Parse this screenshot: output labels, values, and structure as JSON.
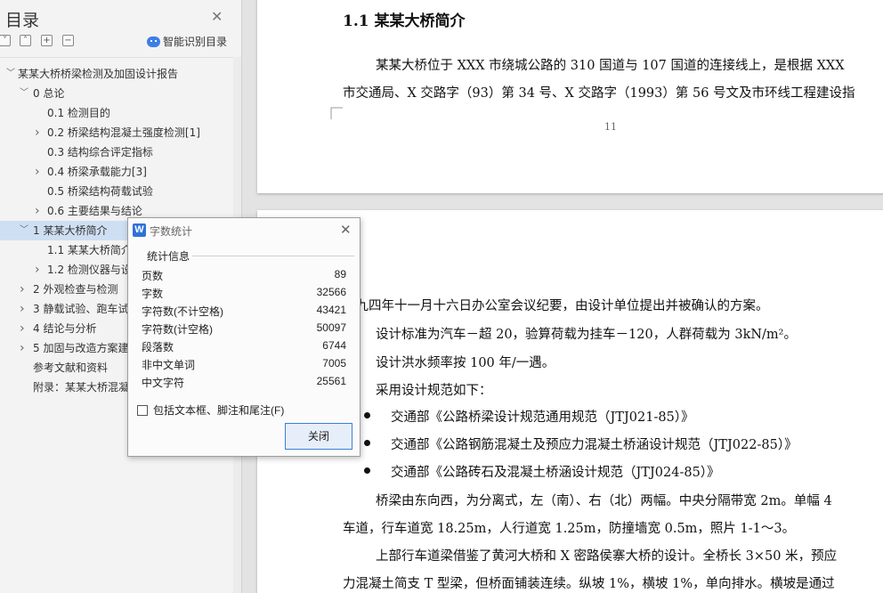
{
  "nav": {
    "title": "目录",
    "smart_label": "智能识别目录",
    "items": [
      {
        "label": "某某大桥桥梁检测及加固设计报告",
        "caret": "﹀"
      },
      {
        "label": "0  总论",
        "caret": "﹀"
      },
      {
        "label": "0.1  检测目的",
        "caret": ""
      },
      {
        "label": "0.2  桥梁结构混凝土强度检测[1]",
        "caret": "›"
      },
      {
        "label": "0.3  结构综合评定指标",
        "caret": ""
      },
      {
        "label": "0.4 桥梁承载能力[3]",
        "caret": "›"
      },
      {
        "label": "0.5  桥梁结构荷载试验",
        "caret": ""
      },
      {
        "label": "0.6  主要结果与结论",
        "caret": "›"
      },
      {
        "label": "1 某某大桥简介",
        "caret": "﹀"
      },
      {
        "label": "1.1 某某大桥简介",
        "caret": ""
      },
      {
        "label": "1.2  检测仪器与设备",
        "caret": "›"
      },
      {
        "label": "2  外观检查与检测",
        "caret": "›"
      },
      {
        "label": "3  静载试验、跑车试验",
        "caret": "›"
      },
      {
        "label": "4  结论与分析",
        "caret": "›"
      },
      {
        "label": "5  加固与改造方案建议",
        "caret": "›"
      },
      {
        "label": "参考文献和资料",
        "caret": ""
      },
      {
        "label": "附录：某某大桥混凝土",
        "caret": ""
      }
    ]
  },
  "document": {
    "heading": "1.1 某某大桥简介",
    "p1_line1": "某某大桥位于 XXX 市绕城公路的 310 国道与 107 国道的连接线上，是根据 XXX",
    "p1_line2": "市交通局、X 交路字（93）第 34 号、X 交路字（1993）第 56 号文及市环线工程建设指",
    "page_number": "11",
    "lines": [
      "部九四年十一月十六日办公室会议纪要，由设计单位提出并被确认的方案。",
      "设计标准为汽车－超 20，验算荷载为挂车－120，人群荷载为 3kN/m²。",
      "设计洪水频率按 100 年/一遇。",
      "采用设计规范如下："
    ],
    "bullets": [
      "交通部《公路桥梁设计规范通用规范（JTJ021-85）》",
      "交通部《公路钢筋混凝土及预应力混凝土桥涵设计规范（JTJ022-85）》",
      "交通部《公路砖石及混凝土桥涵设计规范（JTJ024-85）》"
    ],
    "tail": [
      "桥梁由东向西，为分离式，左（南）、右（北）两幅。中央分隔带宽 2m。单幅 4",
      "车道，行车道宽 18.25m，人行道宽 1.25m，防撞墙宽 0.5m，照片 1-1～3。",
      "上部行车道梁借鉴了黄河大桥和 X 密路侯寨大桥的设计。全桥长 3×50 米，预应",
      "力混凝土简支 T 型梁，但桥面铺装连续。纵坡 1%，横坡 1%，单向排水。横坡是通过"
    ]
  },
  "dialog": {
    "title": "字数统计",
    "group_label": "统计信息",
    "rows": [
      {
        "key": "页数",
        "value": "89"
      },
      {
        "key": "字数",
        "value": "32566"
      },
      {
        "key": "字符数(不计空格)",
        "value": "43421"
      },
      {
        "key": "字符数(计空格)",
        "value": "50097"
      },
      {
        "key": "段落数",
        "value": "6744"
      },
      {
        "key": "非中文单词",
        "value": "7005"
      },
      {
        "key": "中文字符",
        "value": "25561"
      }
    ],
    "checkbox_label": "包括文本框、脚注和尾注(F)",
    "close_label": "关闭"
  }
}
